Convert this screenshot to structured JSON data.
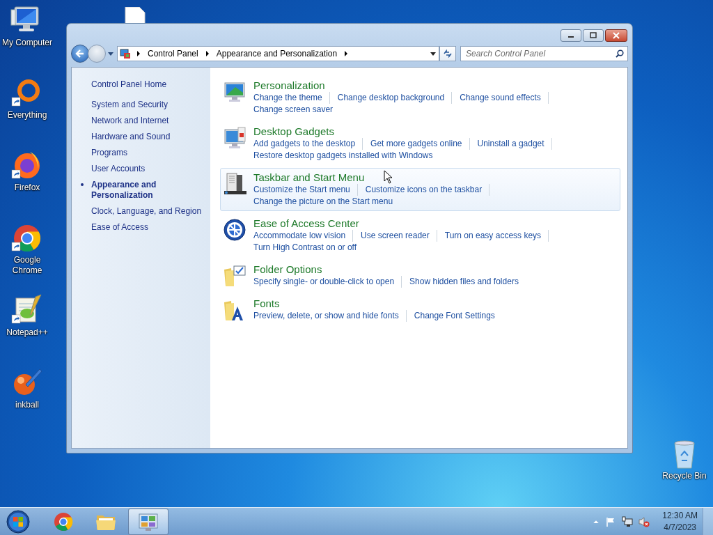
{
  "desktop_icons": [
    {
      "label": "My Computer"
    },
    {
      "label": "Everything"
    },
    {
      "label": "Firefox"
    },
    {
      "label": "Google Chrome"
    },
    {
      "label": "Notepad++"
    },
    {
      "label": "inkball"
    }
  ],
  "recycle_bin": {
    "label": "Recycle Bin"
  },
  "window": {
    "address": {
      "crumbs": [
        "Control Panel",
        "Appearance and Personalization"
      ]
    },
    "search": {
      "placeholder": "Search Control Panel"
    }
  },
  "sidebar": {
    "home": "Control Panel Home",
    "items": [
      {
        "label": "System and Security",
        "selected": false
      },
      {
        "label": "Network and Internet",
        "selected": false
      },
      {
        "label": "Hardware and Sound",
        "selected": false
      },
      {
        "label": "Programs",
        "selected": false
      },
      {
        "label": "User Accounts",
        "selected": false
      },
      {
        "label": "Appearance and Personalization",
        "selected": true
      },
      {
        "label": "Clock, Language, and Region",
        "selected": false
      },
      {
        "label": "Ease of Access",
        "selected": false
      }
    ]
  },
  "categories": [
    {
      "title": "Personalization",
      "highlighted": false,
      "links": [
        [
          "Change the theme",
          "Change desktop background",
          "Change sound effects"
        ],
        [
          "Change screen saver"
        ]
      ]
    },
    {
      "title": "Desktop Gadgets",
      "highlighted": false,
      "links": [
        [
          "Add gadgets to the desktop",
          "Get more gadgets online",
          "Uninstall a gadget"
        ],
        [
          "Restore desktop gadgets installed with Windows"
        ]
      ]
    },
    {
      "title": "Taskbar and Start Menu",
      "highlighted": true,
      "links": [
        [
          "Customize the Start menu",
          "Customize icons on the taskbar"
        ],
        [
          "Change the picture on the Start menu"
        ]
      ]
    },
    {
      "title": "Ease of Access Center",
      "highlighted": false,
      "links": [
        [
          "Accommodate low vision",
          "Use screen reader",
          "Turn on easy access keys"
        ],
        [
          "Turn High Contrast on or off"
        ]
      ]
    },
    {
      "title": "Folder Options",
      "highlighted": false,
      "links": [
        [
          "Specify single- or double-click to open",
          "Show hidden files and folders"
        ]
      ]
    },
    {
      "title": "Fonts",
      "highlighted": false,
      "links": [
        [
          "Preview, delete, or show and hide fonts",
          "Change Font Settings"
        ]
      ]
    }
  ],
  "taskbar": {
    "apps": [
      {
        "selected": false
      },
      {
        "selected": false
      },
      {
        "selected": true
      }
    ],
    "clock": {
      "time": "12:30 AM",
      "date": "4/7/2023"
    }
  }
}
